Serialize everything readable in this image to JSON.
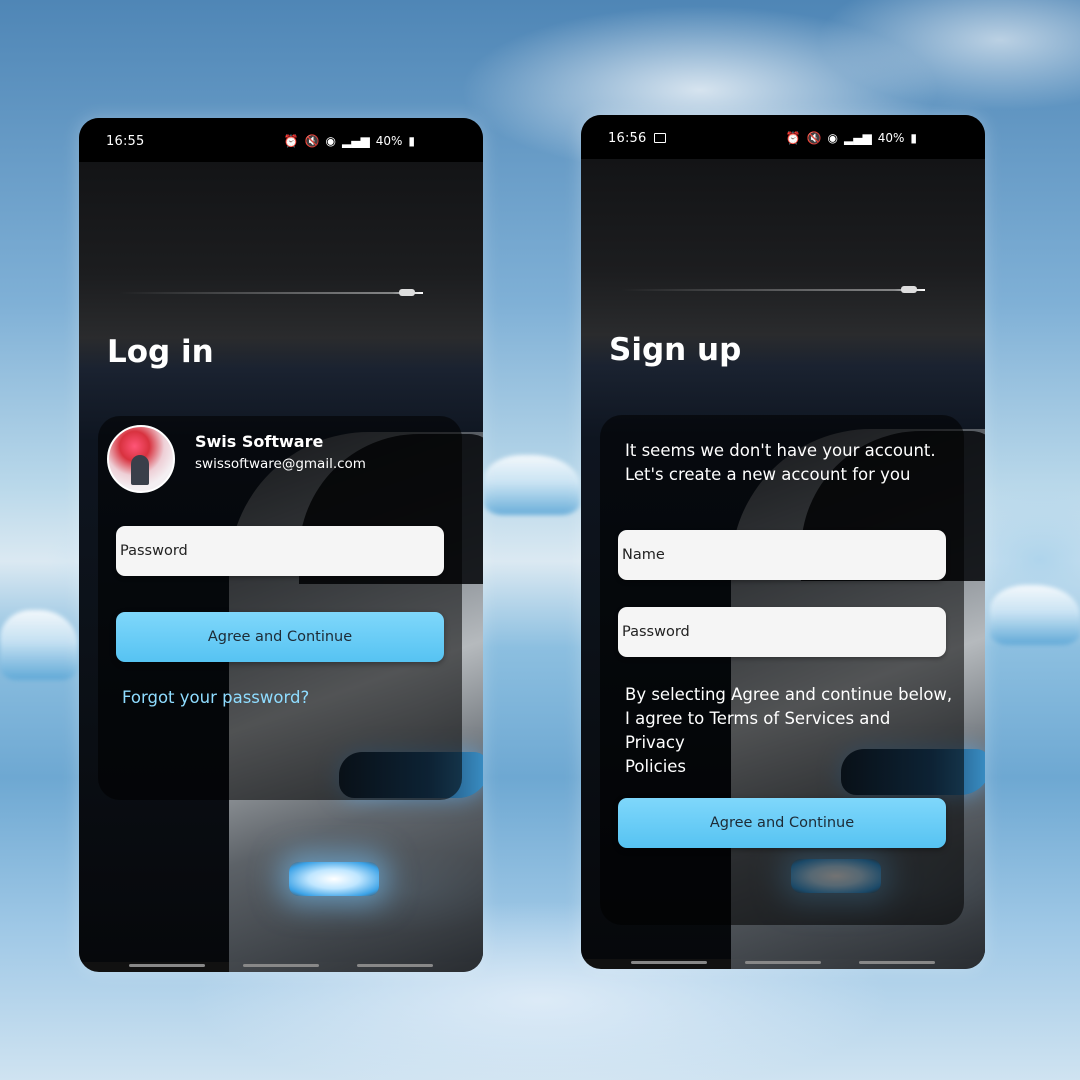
{
  "login_screen": {
    "status_bar": {
      "time": "16:55",
      "icons": [
        "alarm-icon",
        "mute-icon",
        "hotspot-icon",
        "signal-icon"
      ],
      "battery": "40%"
    },
    "title": "Log in",
    "account": {
      "name": "Swis Software",
      "email": "swissoftware@gmail.com"
    },
    "password_placeholder": "Password",
    "continue_label": "Agree and Continue",
    "forgot_label": "Forgot your password?"
  },
  "signup_screen": {
    "status_bar": {
      "time": "16:56",
      "icons": [
        "gallery-icon",
        "alarm-icon",
        "mute-icon",
        "hotspot-icon",
        "signal-icon"
      ],
      "battery": "40%"
    },
    "title": "Sign up",
    "intro": "It seems we don't have your account.\nLet's create a new account for you",
    "name_placeholder": "Name",
    "password_placeholder": "Password",
    "terms": "By selecting Agree and continue below,\nI agree to Terms of Services and Privacy\nPolicies",
    "continue_label": "Agree and Continue"
  },
  "colors": {
    "accent": "#56c3f2",
    "link": "#8fdcff",
    "field_bg": "#f5f5f5"
  }
}
